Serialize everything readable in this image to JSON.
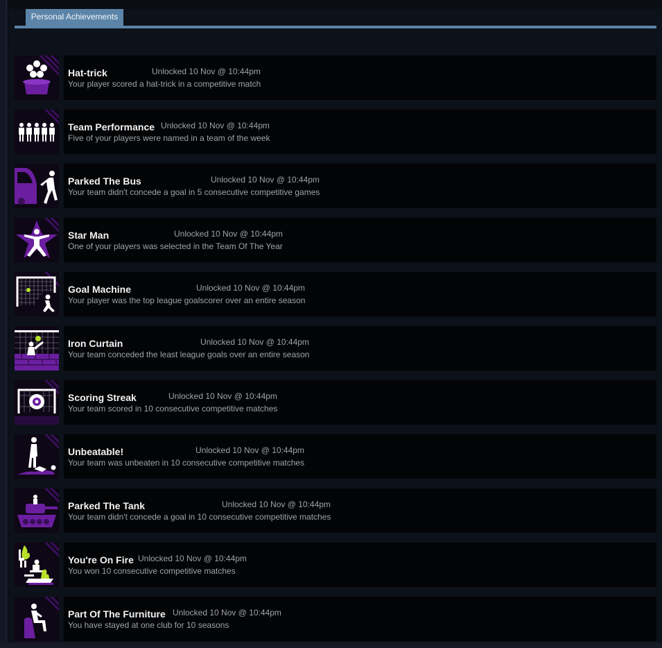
{
  "tab": {
    "label": "Personal Achievements"
  },
  "colors": {
    "accent": "#5b84a8",
    "icon_purple": "#6b1fa0",
    "icon_green": "#b9e22c"
  },
  "achievements": [
    {
      "name": "Hat-trick",
      "unlocked": "Unlocked 10 Nov @ 10:44pm",
      "description": "Your player scored a hat-trick in a competitive match",
      "icon": "top-hat-icon"
    },
    {
      "name": "Team Performance",
      "unlocked": "Unlocked 10 Nov @ 10:44pm",
      "description": "Five of your players were named in a team of the week",
      "icon": "five-players-icon"
    },
    {
      "name": "Parked The Bus",
      "unlocked": "Unlocked 10 Nov @ 10:44pm",
      "description": "Your team didn't concede a goal in 5 consecutive competitive games",
      "icon": "bus-icon"
    },
    {
      "name": "Star Man",
      "unlocked": "Unlocked 10 Nov @ 10:44pm",
      "description": "One of your players was selected in the Team Of The Year",
      "icon": "star-man-icon"
    },
    {
      "name": "Goal Machine",
      "unlocked": "Unlocked 10 Nov @ 10:44pm",
      "description": "Your player was the top league goalscorer over an entire season",
      "icon": "goal-kick-icon"
    },
    {
      "name": "Iron Curtain",
      "unlocked": "Unlocked 10 Nov @ 10:44pm",
      "description": "Your team conceded the least league goals over an entire season",
      "icon": "goalkeeper-wall-icon"
    },
    {
      "name": "Scoring Streak",
      "unlocked": "Unlocked 10 Nov @ 10:44pm",
      "description": "Your team scored in 10 consecutive competitive matches",
      "icon": "goal-target-icon"
    },
    {
      "name": "Unbeatable!",
      "unlocked": "Unlocked 10 Nov @ 10:44pm",
      "description": "Your team was unbeaten in 10 consecutive competitive matches",
      "icon": "standing-over-player-icon"
    },
    {
      "name": "Parked The Tank",
      "unlocked": "Unlocked 10 Nov @ 10:44pm",
      "description": "Your team didn't concede a goal in 10 consecutive competitive matches",
      "icon": "tank-icon"
    },
    {
      "name": "You're On Fire",
      "unlocked": "Unlocked 10 Nov @ 10:44pm",
      "description": "You won 10 consecutive competitive matches",
      "icon": "fire-icon"
    },
    {
      "name": "Part Of The Furniture",
      "unlocked": "Unlocked 10 Nov @ 10:44pm",
      "description": "You have stayed at one club for 10 seasons",
      "icon": "seated-player-icon"
    }
  ]
}
